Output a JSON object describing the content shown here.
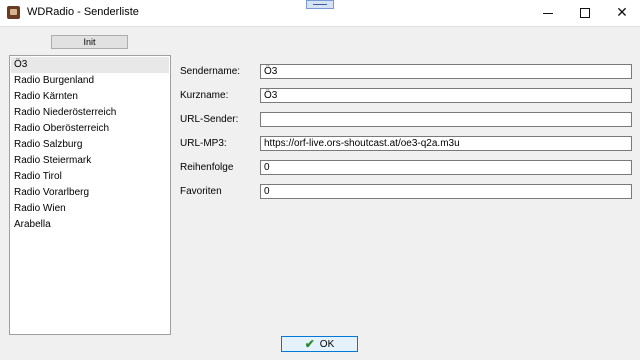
{
  "window": {
    "title": "WDRadio - Senderliste",
    "min_glyph": "minimize-icon",
    "max_glyph": "maximize-icon",
    "close_symbol": "✕"
  },
  "toolbar": {
    "init_label": "Init"
  },
  "stations": [
    "Ö3",
    "Radio Burgenland",
    "Radio Kärnten",
    "Radio Niederösterreich",
    "Radio Oberösterreich",
    "Radio Salzburg",
    "Radio Steiermark",
    "Radio Tirol",
    "Radio Vorarlberg",
    "Radio Wien",
    "Arabella"
  ],
  "selected_station": "Ö3",
  "form": {
    "sendername_label": "Sendername:",
    "sendername_value": "Ö3",
    "kurzname_label": "Kurzname:",
    "kurzname_value": "Ö3",
    "url_sender_label": "URL-Sender:",
    "url_sender_value": "",
    "url_mp3_label": "URL-MP3:",
    "url_mp3_value": "https://orf-live.ors-shoutcast.at/oe3-q2a.m3u",
    "reihenfolge_label": "Reihenfolge",
    "reihenfolge_value": "0",
    "favoriten_label": "Favoriten",
    "favoriten_value": "0"
  },
  "footer": {
    "ok_label": "OK",
    "ok_icon": "checkmark-icon"
  }
}
